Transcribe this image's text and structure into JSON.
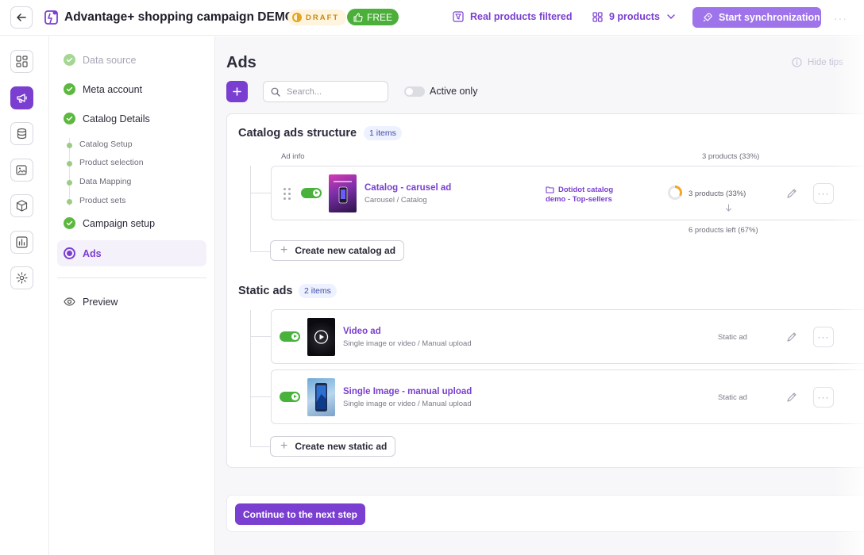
{
  "topbar": {
    "title": "Advantage+ shopping campaign DEMO",
    "draft_badge": "DRAFT",
    "free_badge": "FREE",
    "filter_link": "Real products filtered",
    "products_link": "9 products",
    "sync_button": "Start synchronization"
  },
  "steps": {
    "data_source": "Data source",
    "meta_account": "Meta account",
    "catalog_details": "Catalog Details",
    "catalog_setup": "Catalog Setup",
    "product_selection": "Product selection",
    "data_mapping": "Data Mapping",
    "product_sets": "Product sets",
    "campaign_setup": "Campaign setup",
    "ads": "Ads",
    "preview": "Preview"
  },
  "main": {
    "title": "Ads",
    "hide_tips": "Hide tips",
    "search_placeholder": "Search...",
    "active_only": "Active only"
  },
  "catalog_section": {
    "title": "Catalog ads structure",
    "count": "1 items",
    "col_ad_info": "Ad info",
    "col_products": "3 products (33%)",
    "ad": {
      "name": "Catalog - carusel ad",
      "subtitle": "Carousel / Catalog",
      "catalog_line1": "Dotidot catalog",
      "catalog_line2": "demo - Top-sellers",
      "products": "3 products (33%)",
      "progress_fraction": 0.33
    },
    "products_left": "6 products left (67%)",
    "create_button": "Create new catalog ad"
  },
  "static_section": {
    "title": "Static ads",
    "count": "2 items",
    "ads": [
      {
        "name": "Video ad",
        "subtitle": "Single image or video / Manual upload",
        "type": "Static ad"
      },
      {
        "name": "Single Image - manual upload",
        "subtitle": "Single image or video / Manual upload",
        "type": "Static ad"
      }
    ],
    "create_button": "Create new static ad"
  },
  "footer": {
    "continue_button": "Continue to the next step"
  },
  "colors": {
    "accent": "#7a3fd0",
    "success": "#48b23a",
    "draft": "#c98a13"
  },
  "icons": [
    "back-arrow-icon",
    "app-logo-icon",
    "thumbs-up-icon",
    "filter-icon",
    "grid-icon",
    "chevron-down-icon",
    "rocket-icon",
    "more-icon",
    "dashboard-icon",
    "megaphone-icon",
    "database-icon",
    "image-edit-icon",
    "box-icon",
    "bar-chart-icon",
    "gear-icon",
    "check-icon",
    "eye-icon",
    "info-icon",
    "plus-icon",
    "search-icon",
    "drag-handle-icon",
    "folder-icon",
    "pencil-icon",
    "arrow-down-icon",
    "play-icon"
  ]
}
